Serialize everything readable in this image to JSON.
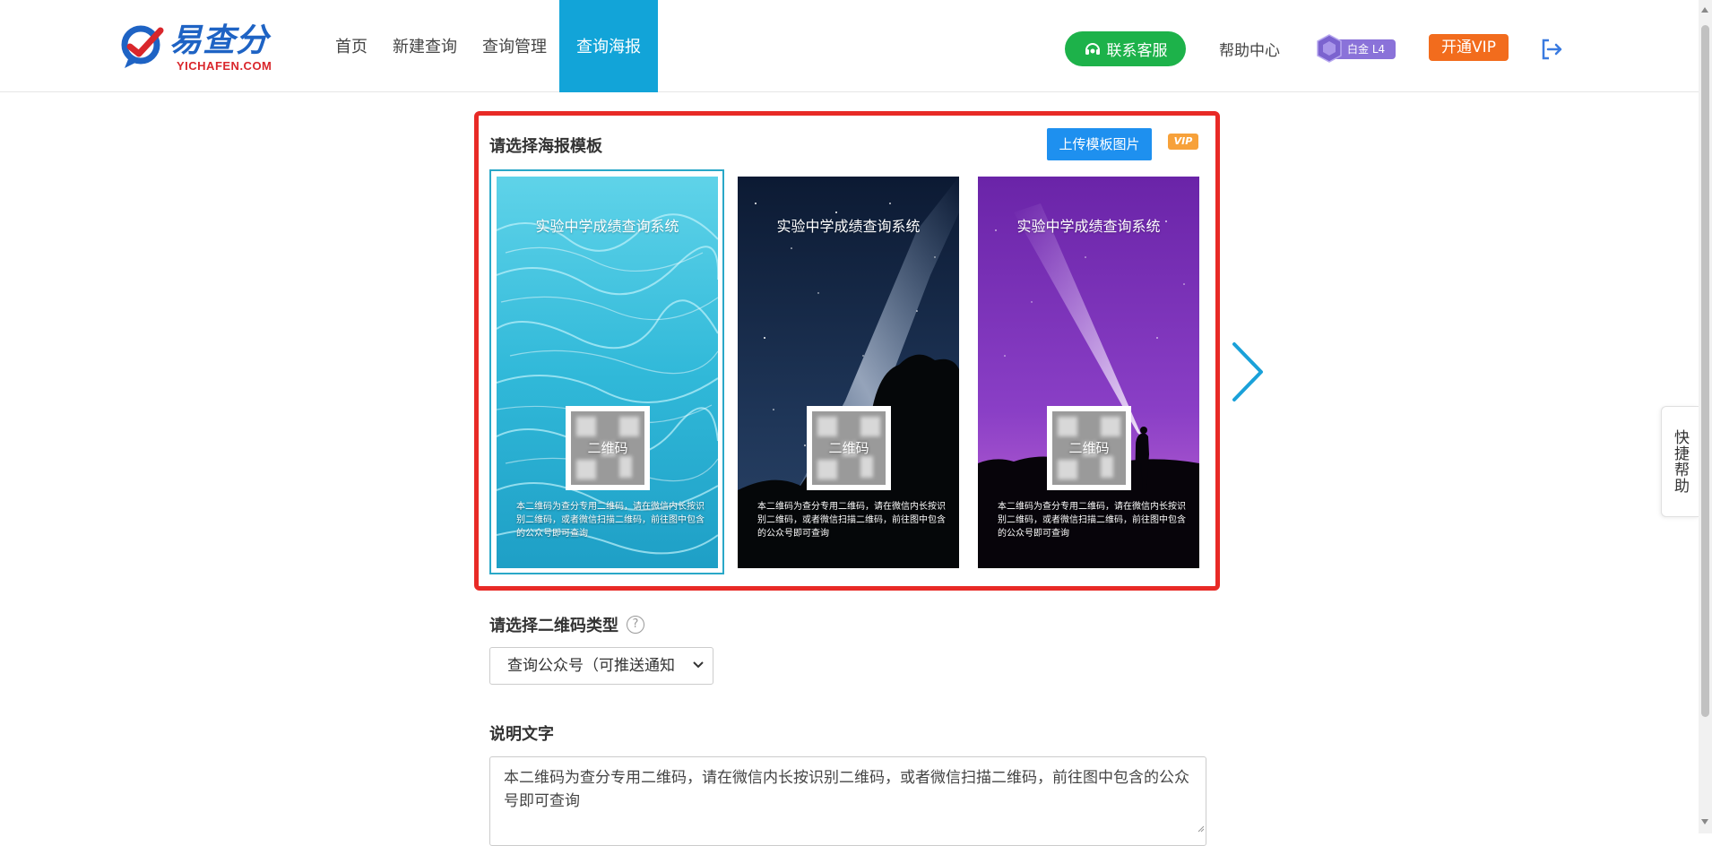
{
  "header": {
    "logo_text": "易查分",
    "logo_sub": "YICHAFEN.COM",
    "nav": [
      "首页",
      "新建查询",
      "查询管理",
      "查询海报"
    ],
    "service_button": "联系客服",
    "help_link": "帮助中心",
    "level_badge": "白金 L4",
    "vip_button": "开通VIP"
  },
  "templates": {
    "title": "请选择海报模板",
    "upload_button": "上传模板图片",
    "vip_tag": "VIP",
    "cards": [
      {
        "title": "实验中学成绩查询系统",
        "qr_label": "二维码",
        "desc": "本二维码为查分专用二维码，请在微信内长按识别二维码，或者微信扫描二维码，前往图中包含的公众号即可查询"
      },
      {
        "title": "实验中学成绩查询系统",
        "qr_label": "二维码",
        "desc": "本二维码为查分专用二维码，请在微信内长按识别二维码，或者微信扫描二维码，前往图中包含的公众号即可查询"
      },
      {
        "title": "实验中学成绩查询系统",
        "qr_label": "二维码",
        "desc": "本二维码为查分专用二维码，请在微信内长按识别二维码，或者微信扫描二维码，前往图中包含的公众号即可查询"
      }
    ],
    "selected_index": 0
  },
  "qr_type": {
    "title": "请选择二维码类型",
    "help": "?",
    "selected": "查询公众号（可推送通知"
  },
  "description": {
    "title": "说明文字",
    "value": "本二维码为查分专用二维码，请在微信内长按识别二维码，或者微信扫描二维码，前往图中包含的公众号即可查询"
  },
  "quick_help": "快捷帮助",
  "colors": {
    "brand_blue": "#1e63c4",
    "nav_active": "#12a4d8",
    "service_green": "#1db24a",
    "vip_orange": "#f26c1d",
    "highlight_red": "#e82a26",
    "upload_blue": "#1e90ef"
  }
}
